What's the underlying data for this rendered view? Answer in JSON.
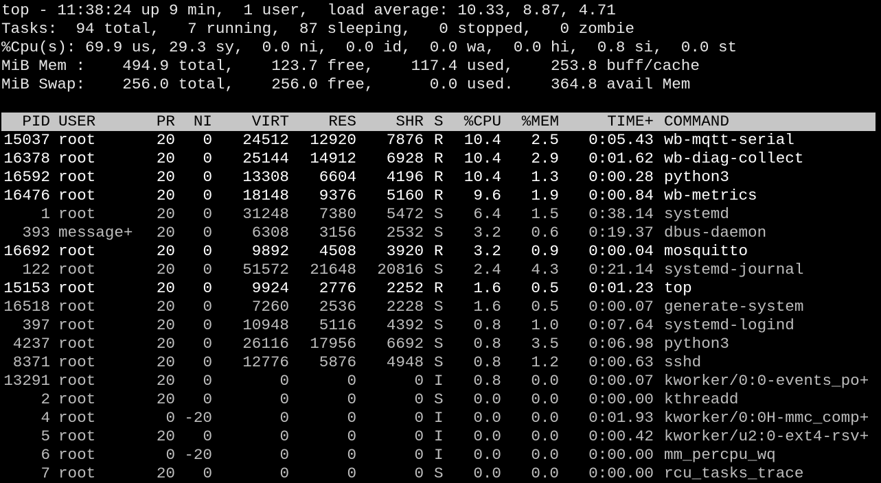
{
  "summary": {
    "line1": "top - 11:38:24 up 9 min,  1 user,  load average: 10.33, 8.87, 4.71",
    "line2": "Tasks:  94 total,   7 running,  87 sleeping,   0 stopped,   0 zombie",
    "line3": "%Cpu(s): 69.9 us, 29.3 sy,  0.0 ni,  0.0 id,  0.0 wa,  0.0 hi,  0.8 si,  0.0 st",
    "line4": "MiB Mem :    494.9 total,    123.7 free,    117.4 used,    253.8 buff/cache",
    "line5": "MiB Swap:    256.0 total,    256.0 free,      0.0 used.    364.8 avail Mem"
  },
  "columns": {
    "pid": "PID",
    "user": "USER",
    "pr": "PR",
    "ni": "NI",
    "virt": "VIRT",
    "res": "RES",
    "shr": "SHR",
    "s": "S",
    "cpu": "%CPU",
    "mem": "%MEM",
    "time": "TIME+",
    "command": "COMMAND"
  },
  "colors": {
    "background": "#000000",
    "header_bar": "#c6c6c6",
    "running_text": "#ffffff",
    "sleeping_text": "#bdbdbd"
  },
  "processes": [
    {
      "pid": "15037",
      "user": "root",
      "pr": "20",
      "ni": "0",
      "virt": "24512",
      "res": "12920",
      "shr": "7876",
      "s": "R",
      "cpu": "10.4",
      "mem": "2.5",
      "time": "0:05.43",
      "command": "wb-mqtt-serial"
    },
    {
      "pid": "16378",
      "user": "root",
      "pr": "20",
      "ni": "0",
      "virt": "25144",
      "res": "14912",
      "shr": "6928",
      "s": "R",
      "cpu": "10.4",
      "mem": "2.9",
      "time": "0:01.62",
      "command": "wb-diag-collect"
    },
    {
      "pid": "16592",
      "user": "root",
      "pr": "20",
      "ni": "0",
      "virt": "13308",
      "res": "6604",
      "shr": "4196",
      "s": "R",
      "cpu": "10.4",
      "mem": "1.3",
      "time": "0:00.28",
      "command": "python3"
    },
    {
      "pid": "16476",
      "user": "root",
      "pr": "20",
      "ni": "0",
      "virt": "18148",
      "res": "9376",
      "shr": "5160",
      "s": "R",
      "cpu": "9.6",
      "mem": "1.9",
      "time": "0:00.84",
      "command": "wb-metrics"
    },
    {
      "pid": "1",
      "user": "root",
      "pr": "20",
      "ni": "0",
      "virt": "31248",
      "res": "7380",
      "shr": "5472",
      "s": "S",
      "cpu": "6.4",
      "mem": "1.5",
      "time": "0:38.14",
      "command": "systemd"
    },
    {
      "pid": "393",
      "user": "message+",
      "pr": "20",
      "ni": "0",
      "virt": "6308",
      "res": "3156",
      "shr": "2532",
      "s": "S",
      "cpu": "3.2",
      "mem": "0.6",
      "time": "0:19.37",
      "command": "dbus-daemon"
    },
    {
      "pid": "16692",
      "user": "root",
      "pr": "20",
      "ni": "0",
      "virt": "9892",
      "res": "4508",
      "shr": "3920",
      "s": "R",
      "cpu": "3.2",
      "mem": "0.9",
      "time": "0:00.04",
      "command": "mosquitto"
    },
    {
      "pid": "122",
      "user": "root",
      "pr": "20",
      "ni": "0",
      "virt": "51572",
      "res": "21648",
      "shr": "20816",
      "s": "S",
      "cpu": "2.4",
      "mem": "4.3",
      "time": "0:21.14",
      "command": "systemd-journal"
    },
    {
      "pid": "15153",
      "user": "root",
      "pr": "20",
      "ni": "0",
      "virt": "9924",
      "res": "2776",
      "shr": "2252",
      "s": "R",
      "cpu": "1.6",
      "mem": "0.5",
      "time": "0:01.23",
      "command": "top"
    },
    {
      "pid": "16518",
      "user": "root",
      "pr": "20",
      "ni": "0",
      "virt": "7260",
      "res": "2536",
      "shr": "2228",
      "s": "S",
      "cpu": "1.6",
      "mem": "0.5",
      "time": "0:00.07",
      "command": "generate-system"
    },
    {
      "pid": "397",
      "user": "root",
      "pr": "20",
      "ni": "0",
      "virt": "10948",
      "res": "5116",
      "shr": "4392",
      "s": "S",
      "cpu": "0.8",
      "mem": "1.0",
      "time": "0:07.64",
      "command": "systemd-logind"
    },
    {
      "pid": "4237",
      "user": "root",
      "pr": "20",
      "ni": "0",
      "virt": "26116",
      "res": "17956",
      "shr": "6692",
      "s": "S",
      "cpu": "0.8",
      "mem": "3.5",
      "time": "0:06.98",
      "command": "python3"
    },
    {
      "pid": "8371",
      "user": "root",
      "pr": "20",
      "ni": "0",
      "virt": "12776",
      "res": "5876",
      "shr": "4948",
      "s": "S",
      "cpu": "0.8",
      "mem": "1.2",
      "time": "0:00.63",
      "command": "sshd"
    },
    {
      "pid": "13291",
      "user": "root",
      "pr": "20",
      "ni": "0",
      "virt": "0",
      "res": "0",
      "shr": "0",
      "s": "I",
      "cpu": "0.8",
      "mem": "0.0",
      "time": "0:00.07",
      "command": "kworker/0:0-events_po+"
    },
    {
      "pid": "2",
      "user": "root",
      "pr": "20",
      "ni": "0",
      "virt": "0",
      "res": "0",
      "shr": "0",
      "s": "S",
      "cpu": "0.0",
      "mem": "0.0",
      "time": "0:00.00",
      "command": "kthreadd"
    },
    {
      "pid": "4",
      "user": "root",
      "pr": "0",
      "ni": "-20",
      "virt": "0",
      "res": "0",
      "shr": "0",
      "s": "I",
      "cpu": "0.0",
      "mem": "0.0",
      "time": "0:01.93",
      "command": "kworker/0:0H-mmc_comp+"
    },
    {
      "pid": "5",
      "user": "root",
      "pr": "20",
      "ni": "0",
      "virt": "0",
      "res": "0",
      "shr": "0",
      "s": "I",
      "cpu": "0.0",
      "mem": "0.0",
      "time": "0:00.42",
      "command": "kworker/u2:0-ext4-rsv+"
    },
    {
      "pid": "6",
      "user": "root",
      "pr": "0",
      "ni": "-20",
      "virt": "0",
      "res": "0",
      "shr": "0",
      "s": "I",
      "cpu": "0.0",
      "mem": "0.0",
      "time": "0:00.00",
      "command": "mm_percpu_wq"
    },
    {
      "pid": "7",
      "user": "root",
      "pr": "20",
      "ni": "0",
      "virt": "0",
      "res": "0",
      "shr": "0",
      "s": "S",
      "cpu": "0.0",
      "mem": "0.0",
      "time": "0:00.00",
      "command": "rcu_tasks_trace"
    }
  ]
}
